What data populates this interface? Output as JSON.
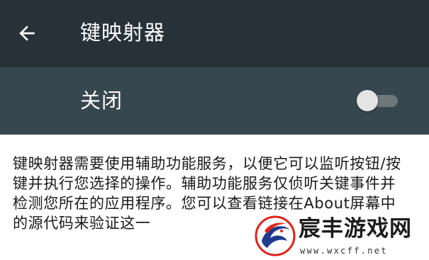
{
  "app_bar": {
    "back_icon": "arrow-back-icon",
    "title": "键映射器"
  },
  "service_toggle": {
    "label": "关闭",
    "checked": false
  },
  "description": "键映射器需要使用辅助功能服务，以便它可以监听按钮/按键并执行您选择的操作。辅助功能服务仅侦听关键事件并检测您所在的应用程序。您可以查看链接在About屏幕中的源代码来验证这一",
  "watermark": {
    "name": "宸丰游戏网",
    "url": "www.wxcff.net"
  },
  "colors": {
    "app_bar_bg": "#263238",
    "toggle_row_bg": "#37474f",
    "switch_thumb": "#e4e4e4",
    "switch_track": "#6d777c",
    "text_primary": "#1a1a1a",
    "watermark_red": "#e2231a",
    "watermark_blue": "#1d3b8f"
  }
}
